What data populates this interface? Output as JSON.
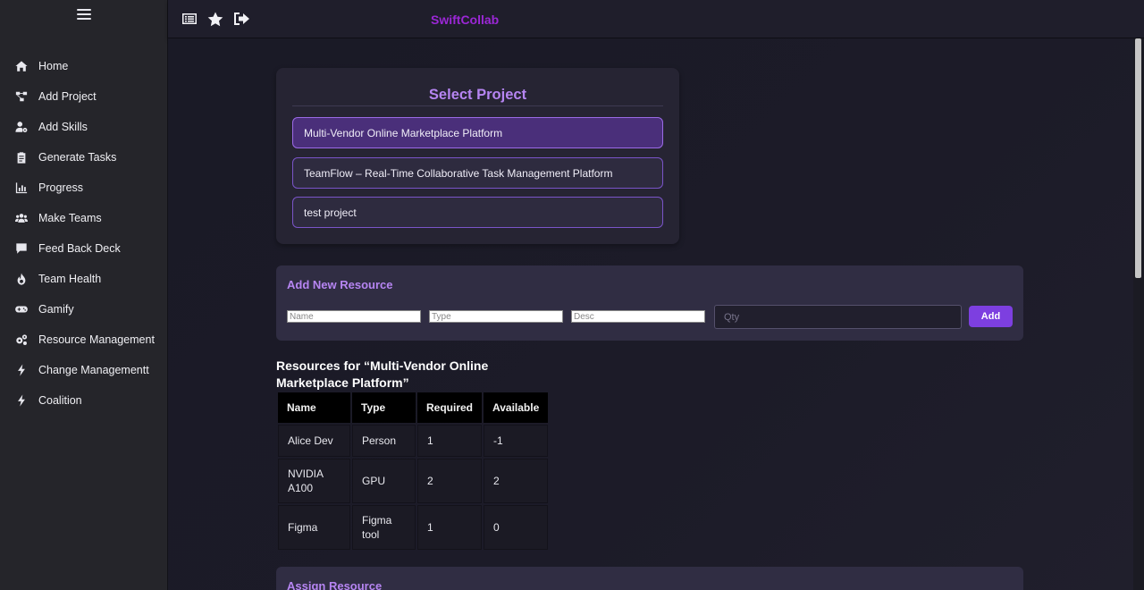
{
  "app": {
    "brand": "SwiftCollab"
  },
  "sidebar": {
    "items": [
      {
        "label": "Home",
        "icon": "home-icon"
      },
      {
        "label": "Add Project",
        "icon": "project-diagram-icon"
      },
      {
        "label": "Add Skills",
        "icon": "user-gear-icon"
      },
      {
        "label": "Generate Tasks",
        "icon": "clipboard-icon"
      },
      {
        "label": "Progress",
        "icon": "bar-chart-icon"
      },
      {
        "label": "Make Teams",
        "icon": "users-icon"
      },
      {
        "label": "Feed Back Deck",
        "icon": "comment-icon"
      },
      {
        "label": "Team Health",
        "icon": "fire-icon"
      },
      {
        "label": "Gamify",
        "icon": "gamepad-icon"
      },
      {
        "label": "Resource Management",
        "icon": "cogs-icon"
      },
      {
        "label": "Change Managementt",
        "icon": "bolt-icon"
      },
      {
        "label": "Coalition",
        "icon": "bolt-icon"
      }
    ]
  },
  "select_project": {
    "title": "Select Project",
    "projects": [
      {
        "name": "Multi-Vendor Online Marketplace Platform",
        "selected": true
      },
      {
        "name": "TeamFlow – Real-Time Collaborative Task Management Platform",
        "selected": false
      },
      {
        "name": "test project",
        "selected": false
      }
    ]
  },
  "add_resource": {
    "title": "Add New Resource",
    "name_placeholder": "Name",
    "type_placeholder": "Type",
    "desc_placeholder": "Desc",
    "qty_placeholder": "Qty",
    "add_label": "Add"
  },
  "resources": {
    "title": "Resources for “Multi-Vendor Online Marketplace Platform”",
    "columns": [
      "Name",
      "Type",
      "Required",
      "Available"
    ],
    "rows": [
      [
        "Alice Dev",
        "Person",
        "1",
        "-1"
      ],
      [
        "NVIDIA A100",
        "GPU",
        "2",
        "2"
      ],
      [
        "Figma",
        "Figma tool",
        "1",
        "0"
      ]
    ]
  },
  "assign_resource": {
    "title": "Assign Resource"
  },
  "colors": {
    "brand": "#9b27d6",
    "accent": "#b685f2",
    "button": "#7d3fe0"
  }
}
